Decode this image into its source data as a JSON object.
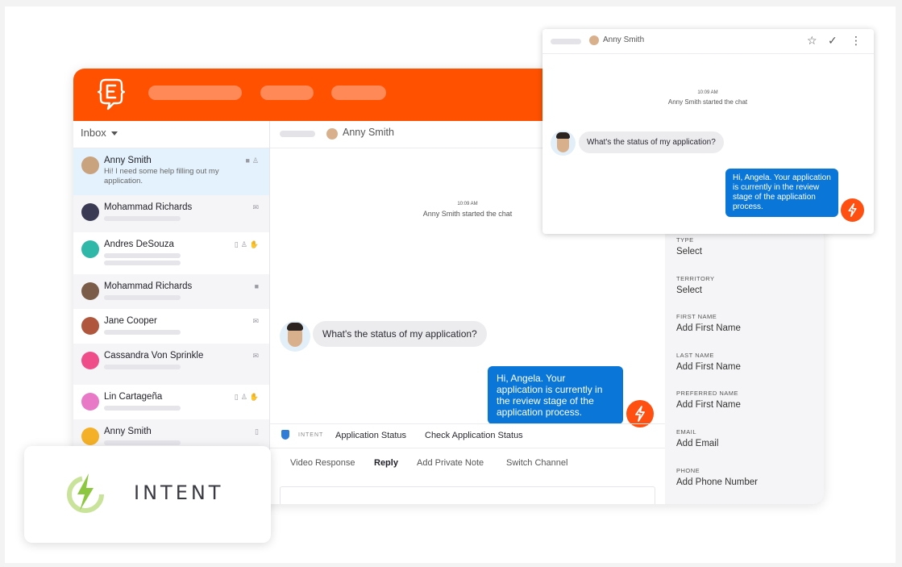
{
  "colors": {
    "brand": "#ff5100",
    "accent_blue": "#0a77d8",
    "bolt": "#ff4f11",
    "intent_green": "#8dc63f"
  },
  "sidebar": {
    "inbox_label": "Inbox",
    "conversations": [
      {
        "name": "Anny Smith",
        "preview": "Hi! I need some help filling out my application.",
        "icons": "message-icon user-icon",
        "avatar_color": "#c9a27e"
      },
      {
        "name": "Mohammad Richards",
        "icons": "mail-icon",
        "avatar_color": "#3a3a55"
      },
      {
        "name": "Andres DeSouza",
        "icons": "phone-icon user-icon hand-icon",
        "avatar_color": "#2fb7a8"
      },
      {
        "name": "Mohammad Richards",
        "icons": "message-icon",
        "avatar_color": "#7a5c49"
      },
      {
        "name": "Jane Cooper",
        "icons": "mail-icon",
        "avatar_color": "#b0563c"
      },
      {
        "name": "Cassandra Von Sprinkle",
        "icons": "mail-icon",
        "avatar_color": "#ef4c8a"
      },
      {
        "name": "Lin Cartageña",
        "icons": "phone-icon user-icon hand-icon",
        "avatar_color": "#e879c7"
      },
      {
        "name": "Anny Smith",
        "icons": "phone-icon",
        "avatar_color": "#f4b128"
      }
    ]
  },
  "chat": {
    "contact_name": "Anny Smith",
    "time": "10:09 AM",
    "started": "Anny Smith started the chat",
    "incoming": "What's the status of my application?",
    "outgoing": "Hi, Angela. Your application is currently in the review stage of the application process.",
    "intent_label": "INTENT",
    "intent_value": "Application Status",
    "intent_action": "Check Application Status",
    "tabs": [
      "Video Response",
      "Reply",
      "Add Private Note",
      "Switch Channel"
    ],
    "active_tab": "Reply"
  },
  "form": {
    "fields": [
      {
        "label": "TYPE",
        "value": "Select"
      },
      {
        "label": "TERRITORY",
        "value": "Select"
      },
      {
        "label": "FIRST NAME",
        "value": "Add First Name"
      },
      {
        "label": "LAST NAME",
        "value": "Add First Name"
      },
      {
        "label": "PREFERRED NAME",
        "value": "Add First Name"
      },
      {
        "label": "EMAIL",
        "value": "Add Email"
      },
      {
        "label": "PHONE",
        "value": "Add Phone Number"
      }
    ]
  },
  "popup": {
    "contact_name": "Anny Smith",
    "time": "10:09 AM",
    "started": "Anny Smith started the chat",
    "incoming": "What's the status of my application?",
    "outgoing": "Hi, Angela. Your application is currently in the review stage of the application process.",
    "actions": [
      "star-icon",
      "check-icon",
      "more-vertical-icon"
    ]
  },
  "intent_card": {
    "word": "INTENT"
  }
}
